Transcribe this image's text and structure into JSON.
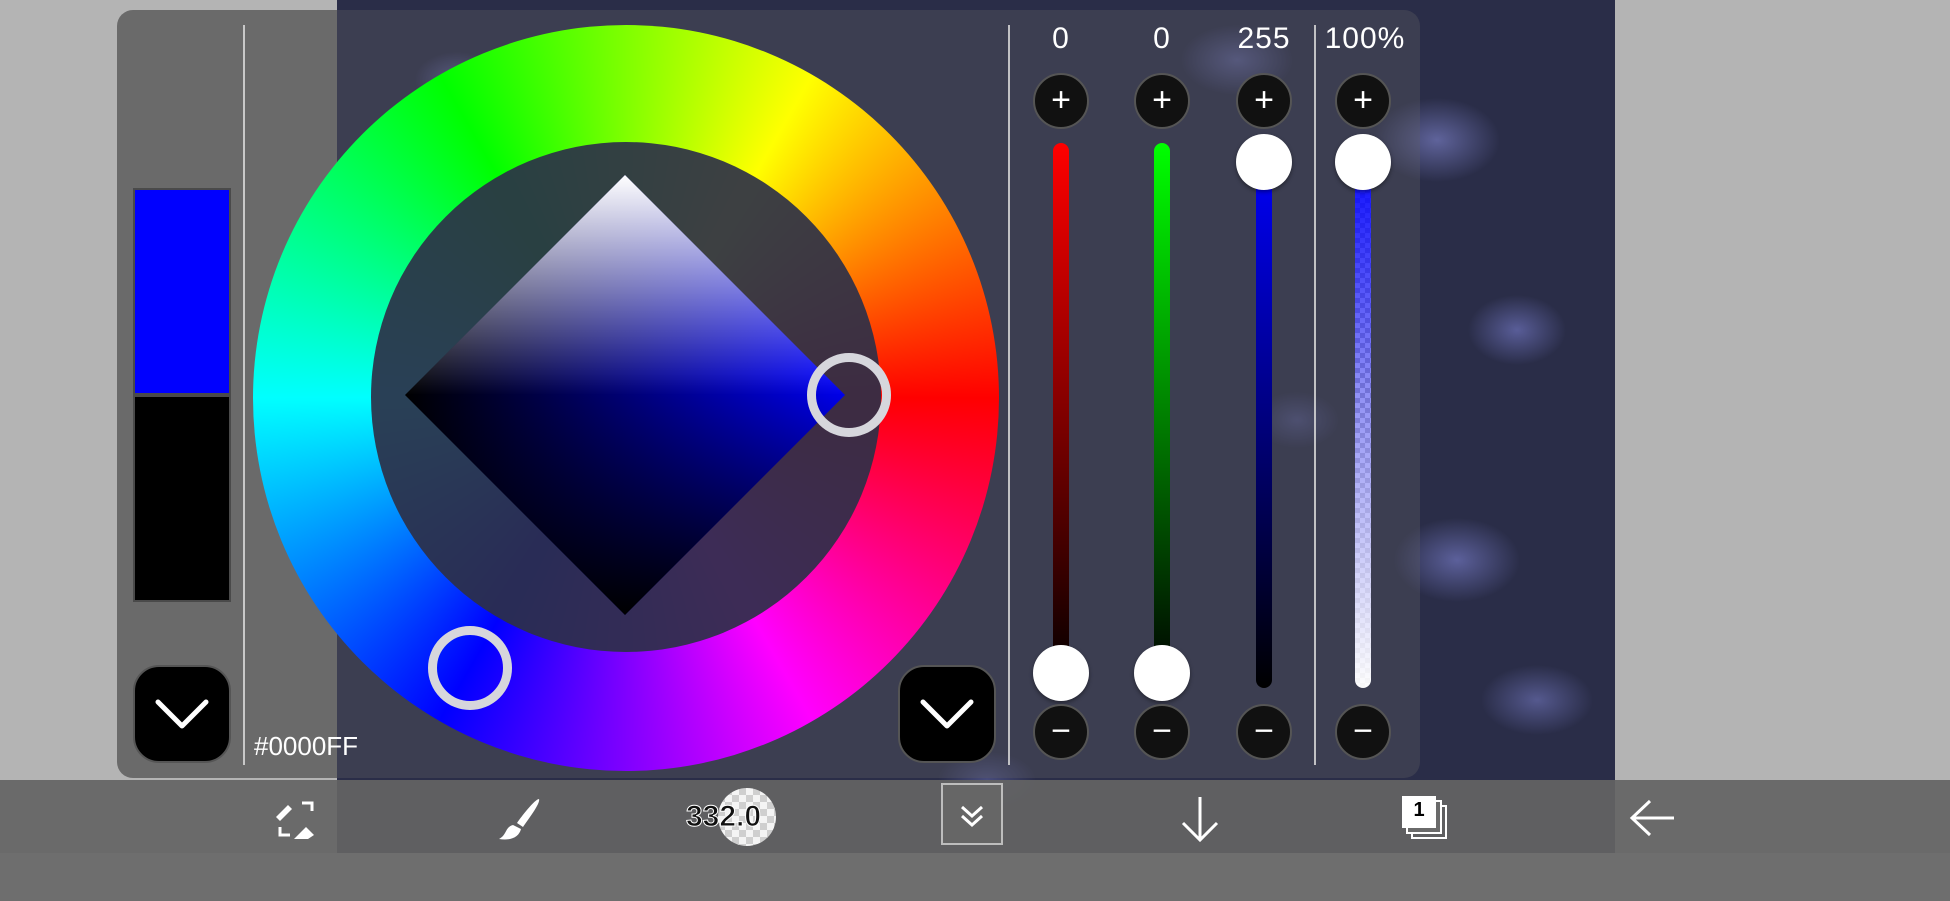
{
  "color": {
    "hex": "#0000FF",
    "primary_swatch": "#0000ff",
    "secondary_swatch": "#000000"
  },
  "channels": {
    "red": {
      "value_label": "0",
      "value": 0,
      "color": "#ff0000"
    },
    "green": {
      "value_label": "0",
      "value": 0,
      "color": "#00ff00"
    },
    "blue": {
      "value_label": "255",
      "value": 255,
      "color": "#0000ff"
    },
    "alpha": {
      "value_label": "100%",
      "value": 100
    }
  },
  "buttons": {
    "plus": "+",
    "minus": "−"
  },
  "toolbar": {
    "brush_size": "332.0",
    "layer_count": "1"
  },
  "icons": {
    "swap": "swap-tools-icon",
    "brush": "brush-icon",
    "collapse": "chevron-down-double-icon",
    "download": "arrow-down-icon",
    "layers": "layers-icon",
    "back": "arrow-left-icon"
  }
}
